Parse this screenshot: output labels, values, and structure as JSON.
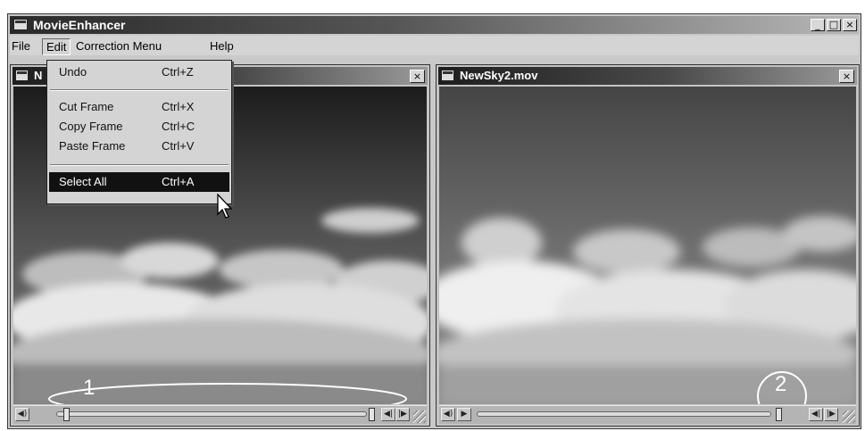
{
  "app": {
    "title": "MovieEnhancer",
    "minimize": "_",
    "maximize": "□",
    "close": "×"
  },
  "menubar": [
    "File",
    "Edit",
    "Correction Menu",
    "Help"
  ],
  "left_window": {
    "title": "N",
    "close": "×"
  },
  "right_window": {
    "title": "NewSky2.mov",
    "close": "×"
  },
  "edit_menu": {
    "undo": {
      "label": "Undo",
      "shortcut": "Ctrl+Z"
    },
    "cut": {
      "label": "Cut Frame",
      "shortcut": "Ctrl+X"
    },
    "copy": {
      "label": "Copy Frame",
      "shortcut": "Ctrl+C"
    },
    "paste": {
      "label": "Paste Frame",
      "shortcut": "Ctrl+V"
    },
    "select_all": {
      "label": "Select All",
      "shortcut": "Ctrl+A"
    }
  },
  "annotations": {
    "one": "1",
    "two": "2"
  },
  "controls": {
    "speaker": "◀)",
    "play": "▶",
    "step_back": "◀|",
    "step_forward": "|▶"
  },
  "icons": [
    "window-icon",
    "speaker-icon",
    "play-icon",
    "step-back-icon",
    "step-forward-icon",
    "resize-grip-icon",
    "mouse-cursor-icon"
  ]
}
